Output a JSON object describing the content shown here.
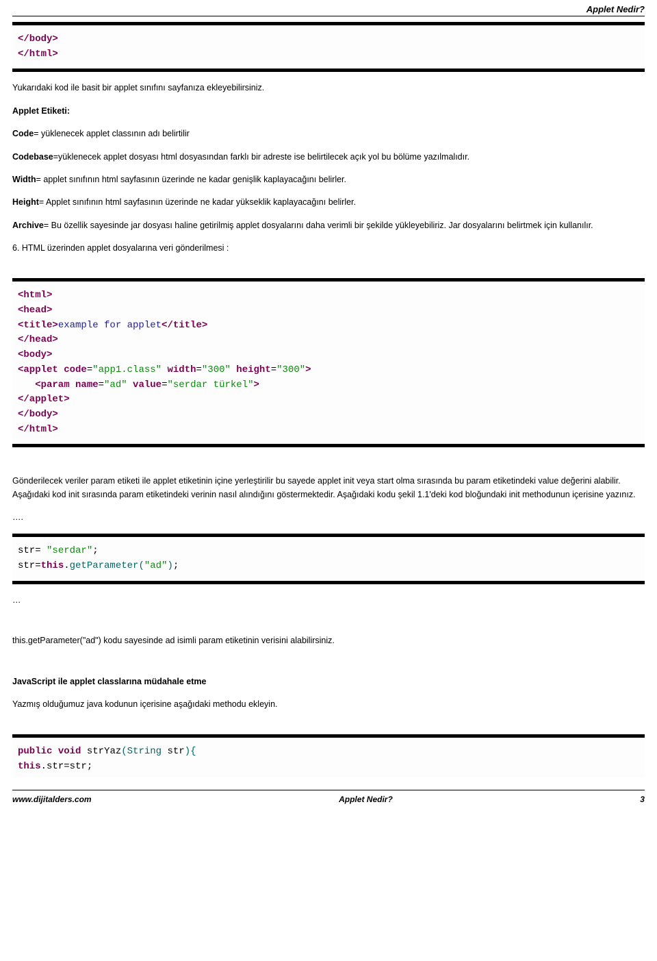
{
  "header": {
    "title": "Applet Nedir?"
  },
  "code1": {
    "l1": "</body>",
    "l2": "</html>"
  },
  "p1": "Yukarıdaki kod ile basit bir applet sınıfını sayfanıza ekleyebilirsiniz.",
  "p2_label": "Applet Etiketi:",
  "p3_b": "Code",
  "p3_t": "= yüklenecek applet classının adı belirtilir",
  "p4_b": "Codebase",
  "p4_t": "=yüklenecek applet dosyası html dosyasından farklı bir adreste ise belirtilecek açık yol bu bölüme yazılmalıdır.",
  "p5_b": "Width",
  "p5_t": "= applet sınıfının html sayfasının üzerinde ne kadar genişlik kaplayacağını belirler.",
  "p6_b": "Height",
  "p6_t": "= Applet sınıfının html sayfasının üzerinde ne kadar yükseklik kaplayacağını belirler.",
  "p7_b": "Archive",
  "p7_t": "= Bu özellik sayesinde jar dosyası haline getirilmiş applet dosyalarını daha verimli bir şekilde yükleyebiliriz. Jar dosyalarını belirtmek için kullanılır.",
  "p8": "6. HTML üzerinden applet dosyalarına veri gönderilmesi :",
  "code2": {
    "l1a": "<html>",
    "l2a": "<head>",
    "l3a": "<title>",
    "l3b": "example for applet",
    "l3c": "</title>",
    "l4a": "</head>",
    "l5a": "<body>",
    "l6a": "<applet ",
    "l6b": "code",
    "l6c": "=",
    "l6d": "\"app1.class\"",
    "l6e": " width",
    "l6f": "=",
    "l6g": "\"300\"",
    "l6h": " height",
    "l6i": "=",
    "l6j": "\"300\"",
    "l6k": ">",
    "l7a": "   <param ",
    "l7b": "name",
    "l7c": "=",
    "l7d": "\"ad\"",
    "l7e": " value",
    "l7f": "=",
    "l7g": "\"serdar türkel\"",
    "l7h": ">",
    "l8a": "</applet>",
    "l9a": "</body>",
    "l10a": "</html>"
  },
  "p9": "Gönderilecek veriler param etiketi ile applet etiketinin içine yerleştirilir bu sayede applet init veya start olma sırasında bu param etiketindeki value değerini alabilir. Aşağıdaki kod init sırasında param etiketindeki verinin  nasıl alındığını göstermektedir. Aşağıdaki kodu şekil 1.1'deki  kod bloğundaki  init methodunun içerisine yazınız.",
  "p10": "….",
  "code3": {
    "l1a": "str= ",
    "l1b": "\"serdar\"",
    "l1c": ";",
    "l2a": "str=",
    "l2b": "this",
    "l2c": ".",
    "l2d": "getParameter",
    "l2e": "(",
    "l2f": "\"ad\"",
    "l2g": ")",
    "l2h": ";"
  },
  "p11": "…",
  "p12": "this.getParameter(\"ad\") kodu sayesinde ad isimli param etiketinin verisini alabilirsiniz.",
  "p13": "JavaScript ile applet classlarına müdahale etme",
  "p14": "Yazmış olduğumuz java kodunun içerisine aşağıdaki methodu ekleyin.",
  "code4": {
    "l1a": "public",
    "l1b": " ",
    "l1c": "void",
    "l1d": " strYaz",
    "l1e": "(",
    "l1f": "String",
    "l1g": " str",
    "l1h": ")",
    "l1i": "{",
    "l2a": "this",
    "l2b": ".str=str;"
  },
  "footer": {
    "left": "www.dijitalders.com",
    "center": "Applet Nedir?",
    "right": "3"
  }
}
